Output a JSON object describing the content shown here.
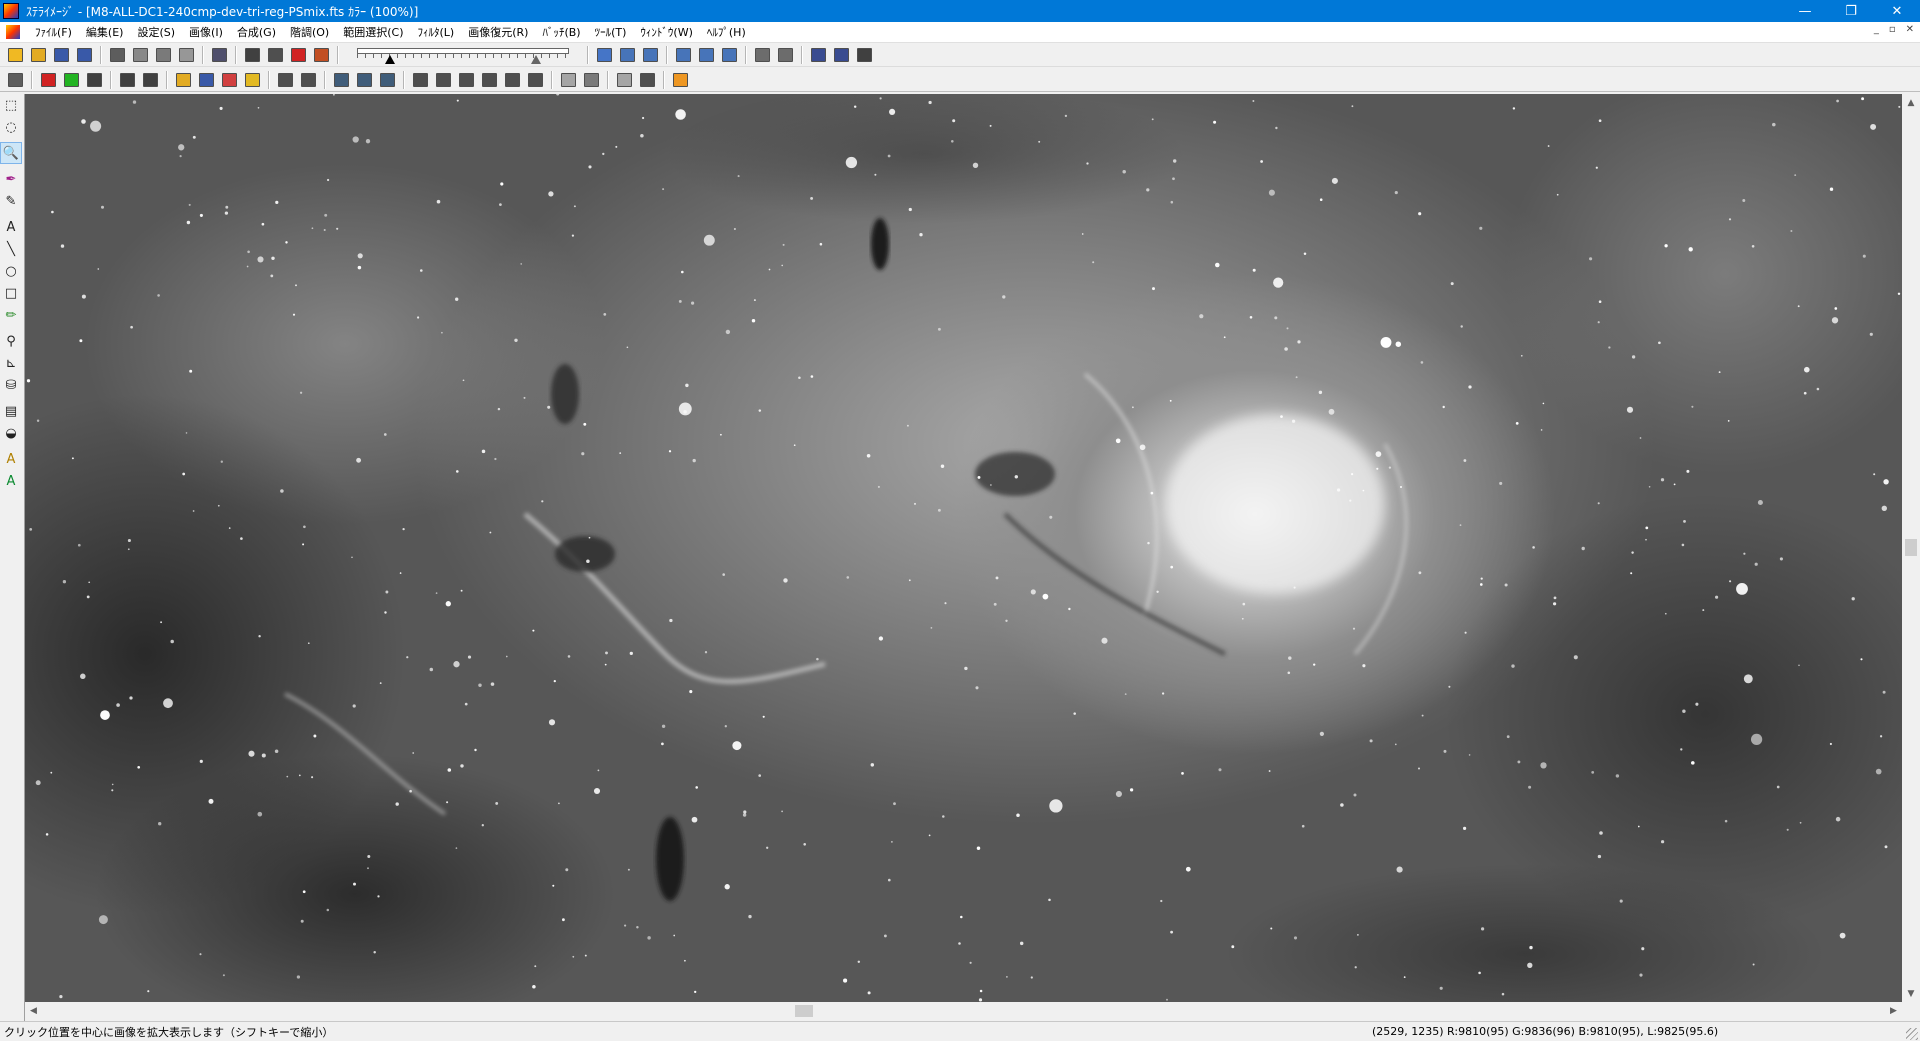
{
  "window": {
    "title": "ｽﾃﾗｲﾒｰｼﾞ  - [M8-ALL-DC1-240cmp-dev-tri-reg-PSmix.fts ｶﾗｰ (100%)]",
    "minimize": "—",
    "restore": "❐",
    "close": "✕"
  },
  "menu": {
    "items": [
      "ﾌｧｲﾙ(F)",
      "編集(E)",
      "設定(S)",
      "画像(I)",
      "合成(G)",
      "階調(O)",
      "範囲選択(C)",
      "ﾌｨﾙﾀ(L)",
      "画像復元(R)",
      "ﾊﾞｯﾁ(B)",
      "ﾂｰﾙ(T)",
      "ｳｨﾝﾄﾞｳ(W)",
      "ﾍﾙﾌﾟ(H)"
    ],
    "mdi_min": "_",
    "mdi_restore": "▫",
    "mdi_close": "✕"
  },
  "colors": {
    "titlebar": "#0078d7",
    "active_tool": "#cde6f7"
  },
  "toolbar1": {
    "icons": [
      "open-icon",
      "browse-icon",
      "save-icon",
      "save-as-icon",
      "print-preview-icon",
      "scan-icon",
      "print-icon",
      "undo-icon",
      "grid-icon",
      "histogram-icon",
      "compare-icon",
      "compare-red-icon",
      "batch-icon"
    ],
    "icons_right": [
      "hand-icon",
      "zoom-in-window-icon",
      "zoom-out-window-icon",
      "zoom-in-icon",
      "zoom-out-icon",
      "fit-icon",
      "grid-view-icon",
      "pen-settings-icon",
      "tone-curve-icon",
      "color-balance-icon",
      "monochrome-icon"
    ]
  },
  "toolbar2": {
    "icons": [
      "duplicate-icon",
      "rgb-split-icon",
      "rgb-merge-icon",
      "stack-icon",
      "levels-icon",
      "binoculars-icon",
      "layers-icon",
      "palette-icon",
      "stripe-icon",
      "color-wheel-icon",
      "contrast-icon",
      "magic-icon",
      "tile-icon",
      "resize-icon",
      "crop-icon",
      "flip-h-icon",
      "flip-v-icon",
      "rotate-cw-icon",
      "rotate-ccw-icon",
      "rotate-free-icon",
      "transform-icon",
      "gray-icon",
      "gradient-icon",
      "copy-icon",
      "paste-icon",
      "info-icon"
    ]
  },
  "tool_palette": {
    "tools": [
      {
        "name": "rect-select-icon",
        "glyph": "⬚"
      },
      {
        "name": "lasso-icon",
        "glyph": "◌"
      },
      {
        "name": "magnify-icon",
        "glyph": "🔍"
      },
      {
        "name": "eyedropper-icon",
        "glyph": "✒"
      },
      {
        "name": "brush-icon",
        "glyph": "✎"
      },
      {
        "name": "text-icon",
        "glyph": "A"
      },
      {
        "name": "line-icon",
        "glyph": "╲"
      },
      {
        "name": "ellipse-icon",
        "glyph": "○"
      },
      {
        "name": "rectangle-icon",
        "glyph": "□"
      },
      {
        "name": "pencil-icon",
        "glyph": "✏"
      },
      {
        "name": "stamp-icon",
        "glyph": "⚲"
      },
      {
        "name": "measure-icon",
        "glyph": "⊾"
      },
      {
        "name": "fill-icon",
        "glyph": "⛁"
      },
      {
        "name": "chart-icon",
        "glyph": "▤"
      },
      {
        "name": "ruler-icon",
        "glyph": "◒"
      },
      {
        "name": "auto-adjust-icon",
        "glyph": "A"
      },
      {
        "name": "auto-color-icon",
        "glyph": "A"
      }
    ],
    "active_index": 2
  },
  "scroll": {
    "up": "▲",
    "down": "▼",
    "left": "◀",
    "right": "▶"
  },
  "status": {
    "hint": "クリック位置を中心に画像を拡大表示します（シフトキーで縮小）",
    "pixel_info": "(2529, 1235) R:9810(95) G:9836(96) B:9810(95), L:9825(95.6)"
  }
}
